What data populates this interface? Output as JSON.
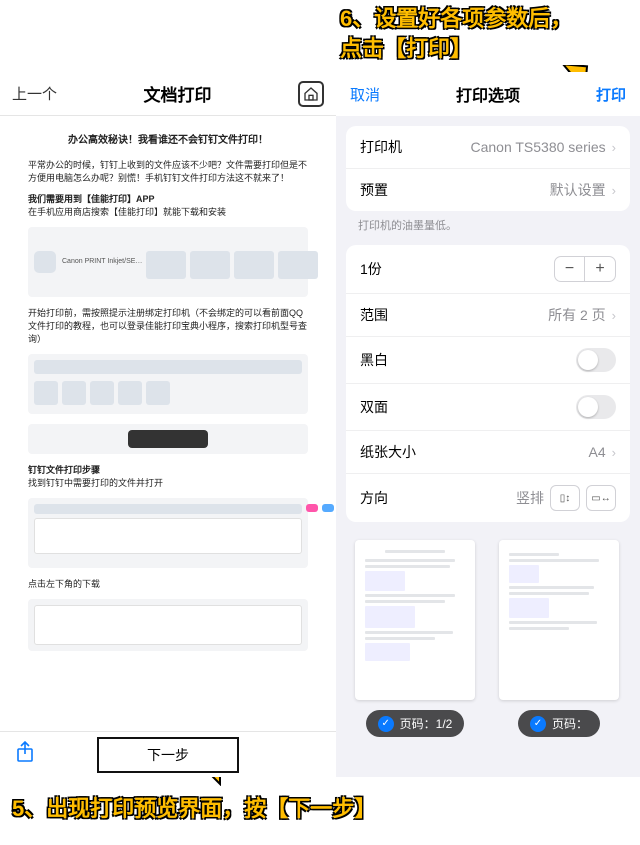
{
  "annotations": {
    "step6_line1": "6、设置好各项参数后，",
    "step6_line2": "点击【打印】",
    "step5": "5、出现打印预览界面，按【下一步】"
  },
  "left": {
    "back": "上一个",
    "title": "文档打印",
    "headline": "办公高效秘诀！我看谁还不会钉钉文件打印！",
    "para1": "平常办公的时候，钉钉上收到的文件应该不少吧？文件需要打印但是不方便用电脑怎么办呢？别慌！手机钉钉文件打印方法这不就来了！",
    "bold1": "我们需要用到【佳能打印】APP",
    "para2": "在手机应用商店搜索【佳能打印】就能下载和安装",
    "thumb_app_title": "Canon PRINT Inkjet/SE…",
    "para3": "开始打印前，需按照提示注册绑定打印机（不会绑定的可以看前面QQ文件打印的教程，也可以登录佳能打印宝典小程序，搜索打印机型号查询）",
    "bold2": "钉钉文件打印步骤",
    "para4": "找到钉钉中需要打印的文件并打开",
    "para5": "点击左下角的下载",
    "next": "下一步"
  },
  "right": {
    "cancel": "取消",
    "title": "打印选项",
    "print": "打印",
    "printer_label": "打印机",
    "printer_value": "Canon TS5380 series",
    "preset_label": "预置",
    "preset_value": "默认设置",
    "ink_note": "打印机的油墨量低。",
    "copies_label": "1份",
    "range_label": "范围",
    "range_value": "所有 2 页",
    "bw_label": "黑白",
    "duplex_label": "双面",
    "papersize_label": "纸张大小",
    "papersize_value": "A4",
    "orientation_label": "方向",
    "orientation_value": "竖排",
    "page_badge_1": "页码：1/2",
    "page_badge_2": "页码："
  }
}
